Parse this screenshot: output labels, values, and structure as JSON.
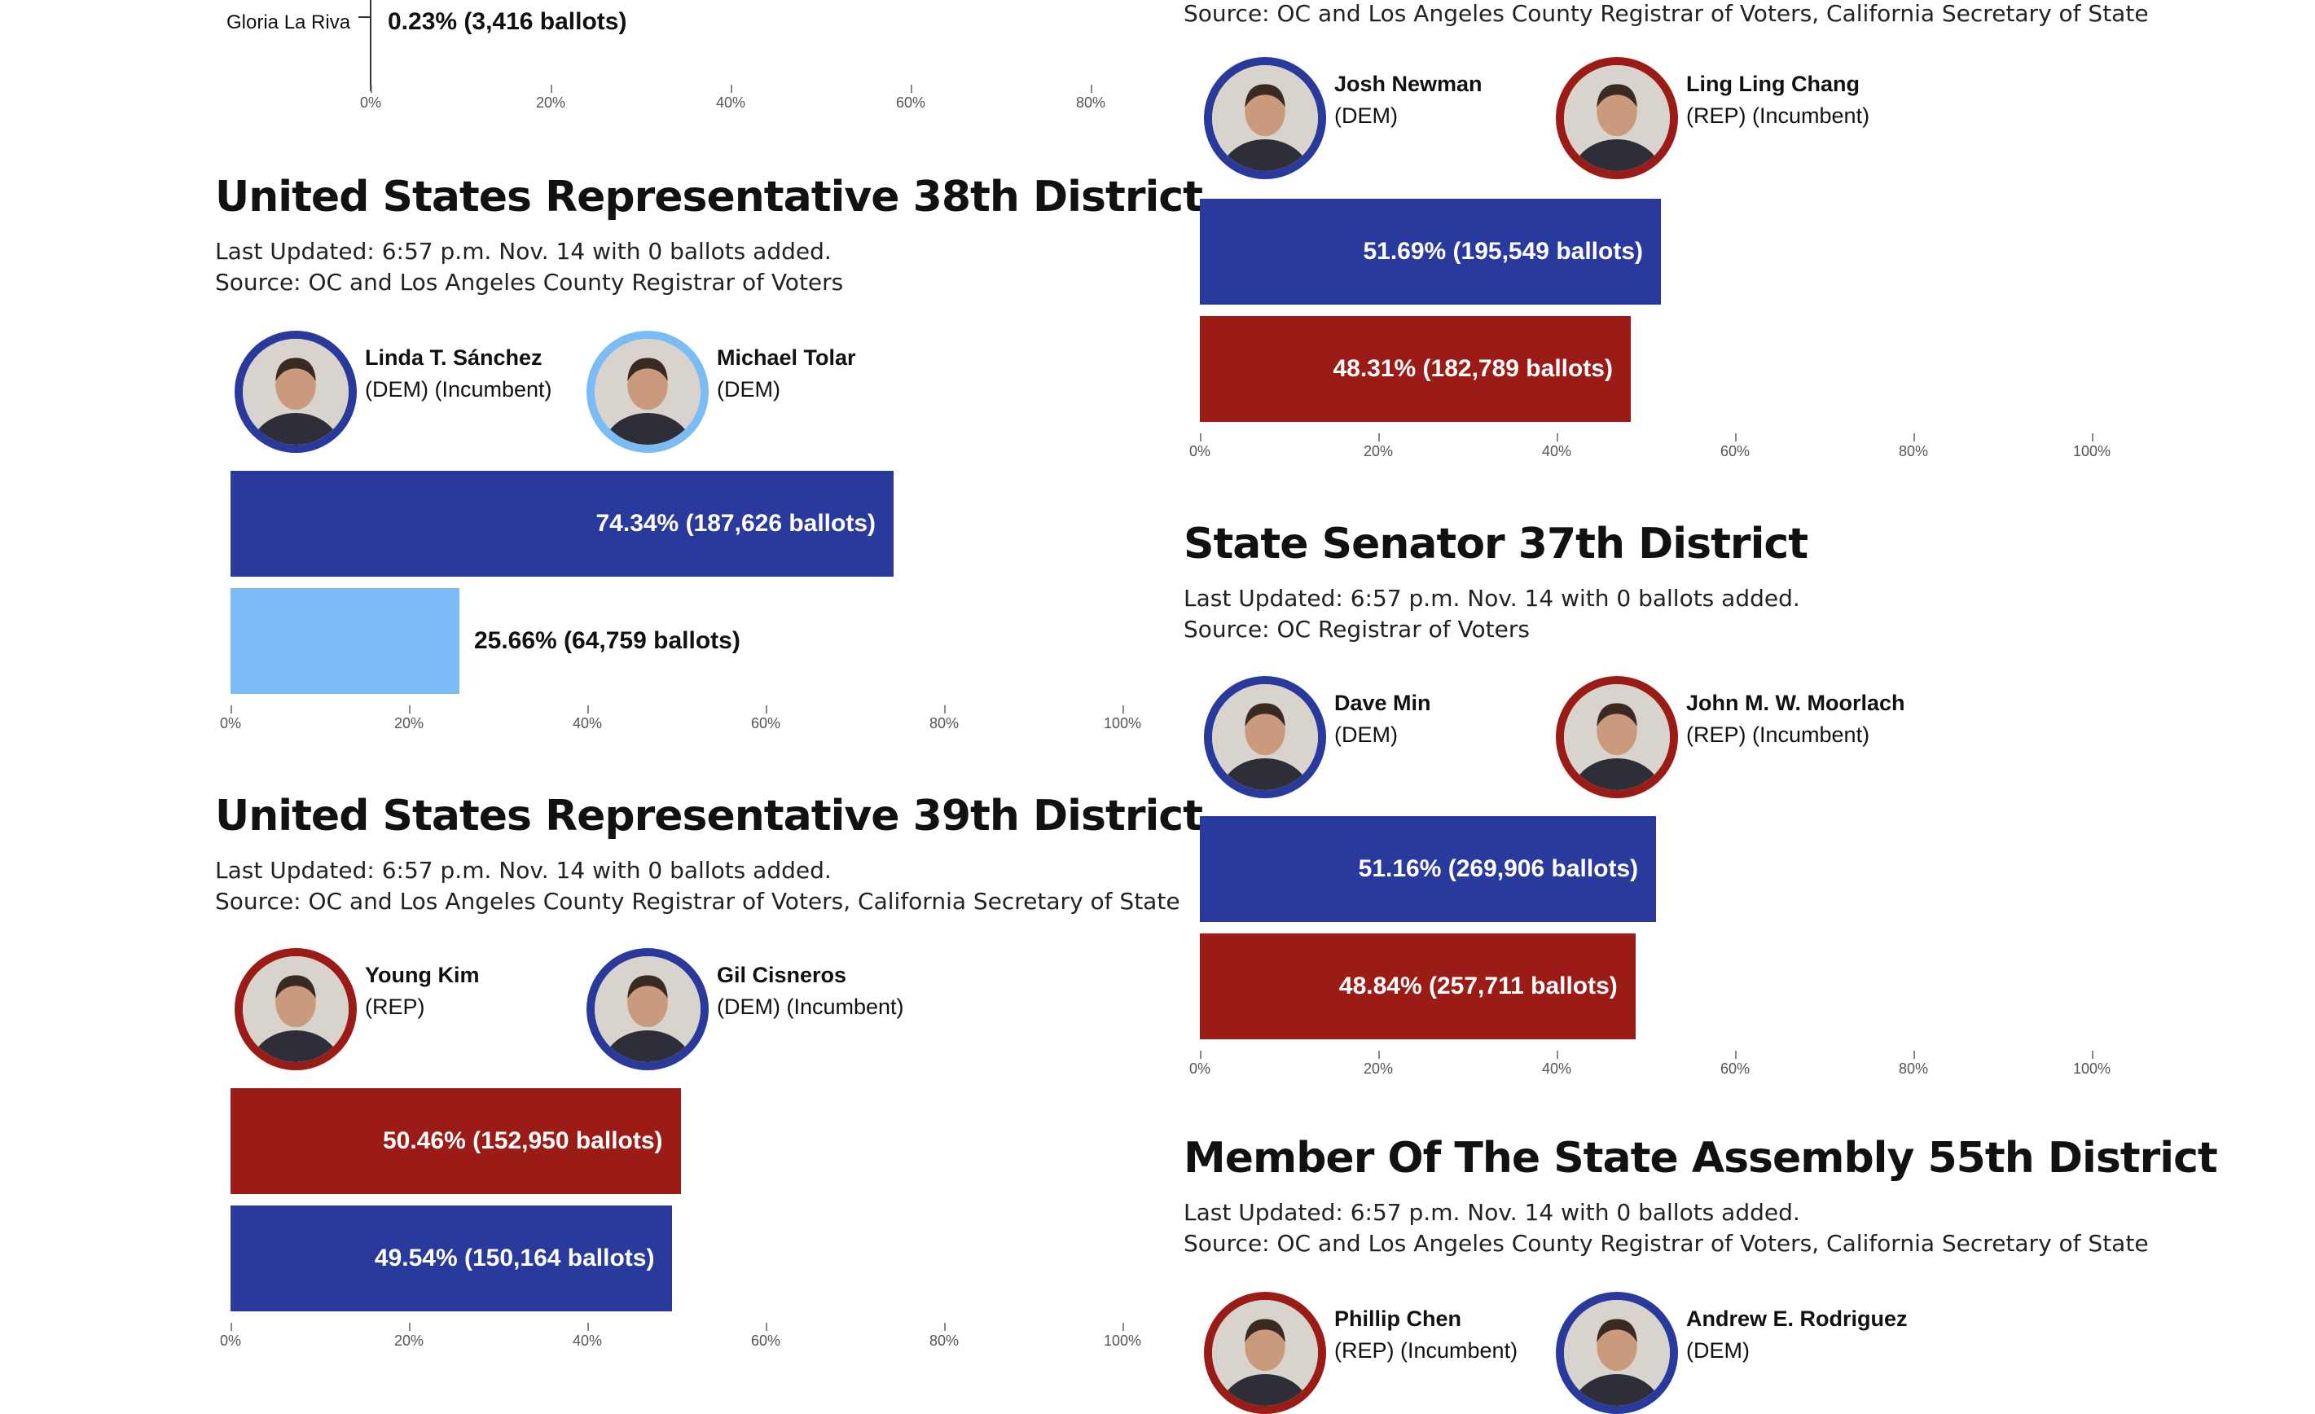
{
  "fragment": {
    "candidate_name": "Gloria La Riva",
    "value_label": "0.23% (3,416 ballots)",
    "value_pct": 0.23
  },
  "axis_ticks": [
    "0%",
    "20%",
    "40%",
    "60%",
    "80%",
    "100%"
  ],
  "colors": {
    "dem": "#2a3a9c",
    "rep": "#9b1b16",
    "dem_light": "#7bbcf7"
  },
  "races": [
    {
      "id": "right-top-fragment",
      "title": "",
      "source": "Source: OC and Los Angeles County Registrar of Voters, California Secretary of State",
      "candidates": [
        {
          "name": "Josh Newman",
          "party": "(DEM)",
          "color": "#2a3a9c",
          "icon": "candidate-photo"
        },
        {
          "name": "Ling Ling Chang",
          "party": "(REP) (Incumbent)",
          "color": "#9b1b16",
          "icon": "candidate-photo"
        }
      ],
      "bars": [
        {
          "pct": 51.69,
          "label": "51.69% (195,549 ballots)",
          "color": "#2a3a9c"
        },
        {
          "pct": 48.31,
          "label": "48.31% (182,789 ballots)",
          "color": "#9b1b16"
        }
      ]
    },
    {
      "id": "us-rep-38",
      "title": "United States Representative 38th District",
      "updated": "Last Updated: 6:57 p.m. Nov. 14 with 0 ballots added.",
      "source": "Source: OC and Los Angeles County Registrar of Voters",
      "candidates": [
        {
          "name": "Linda T. Sánchez",
          "party": "(DEM) (Incumbent)",
          "color": "#2a3a9c",
          "icon": "candidate-photo"
        },
        {
          "name": "Michael Tolar",
          "party": "(DEM)",
          "color": "#7bbcf7",
          "icon": "candidate-photo"
        }
      ],
      "bars": [
        {
          "pct": 74.34,
          "label": "74.34% (187,626 ballots)",
          "color": "#2a3a9c"
        },
        {
          "pct": 25.66,
          "label": "25.66% (64,759 ballots)",
          "color": "#7bbcf7"
        }
      ]
    },
    {
      "id": "us-rep-39",
      "title": "United States Representative 39th District",
      "updated": "Last Updated: 6:57 p.m. Nov. 14 with 0 ballots added.",
      "source": "Source: OC and Los Angeles County Registrar of Voters, California Secretary of State",
      "candidates": [
        {
          "name": "Young Kim",
          "party": "(REP)",
          "color": "#9b1b16",
          "icon": "candidate-photo"
        },
        {
          "name": "Gil Cisneros",
          "party": "(DEM) (Incumbent)",
          "color": "#2a3a9c",
          "icon": "candidate-photo"
        }
      ],
      "bars": [
        {
          "pct": 50.46,
          "label": "50.46% (152,950 ballots)",
          "color": "#9b1b16"
        },
        {
          "pct": 49.54,
          "label": "49.54% (150,164 ballots)",
          "color": "#2a3a9c"
        }
      ]
    },
    {
      "id": "state-senate-37",
      "title": "State Senator 37th District",
      "updated": "Last Updated: 6:57 p.m. Nov. 14 with 0 ballots added.",
      "source": "Source: OC Registrar of Voters",
      "candidates": [
        {
          "name": "Dave Min",
          "party": "(DEM)",
          "color": "#2a3a9c",
          "icon": "candidate-photo"
        },
        {
          "name": "John M. W. Moorlach",
          "party": "(REP) (Incumbent)",
          "color": "#9b1b16",
          "icon": "candidate-photo"
        }
      ],
      "bars": [
        {
          "pct": 51.16,
          "label": "51.16% (269,906 ballots)",
          "color": "#2a3a9c"
        },
        {
          "pct": 48.84,
          "label": "48.84% (257,711 ballots)",
          "color": "#9b1b16"
        }
      ]
    },
    {
      "id": "assembly-55",
      "title": "Member Of The State Assembly 55th District",
      "updated": "Last Updated: 6:57 p.m. Nov. 14 with 0 ballots added.",
      "source": "Source: OC and Los Angeles County Registrar of Voters, California Secretary of State",
      "candidates": [
        {
          "name": "Phillip Chen",
          "party": "(REP) (Incumbent)",
          "color": "#9b1b16",
          "icon": "candidate-photo"
        },
        {
          "name": "Andrew E. Rodriguez",
          "party": "(DEM)",
          "color": "#2a3a9c",
          "icon": "candidate-photo"
        }
      ],
      "bars": []
    }
  ]
}
